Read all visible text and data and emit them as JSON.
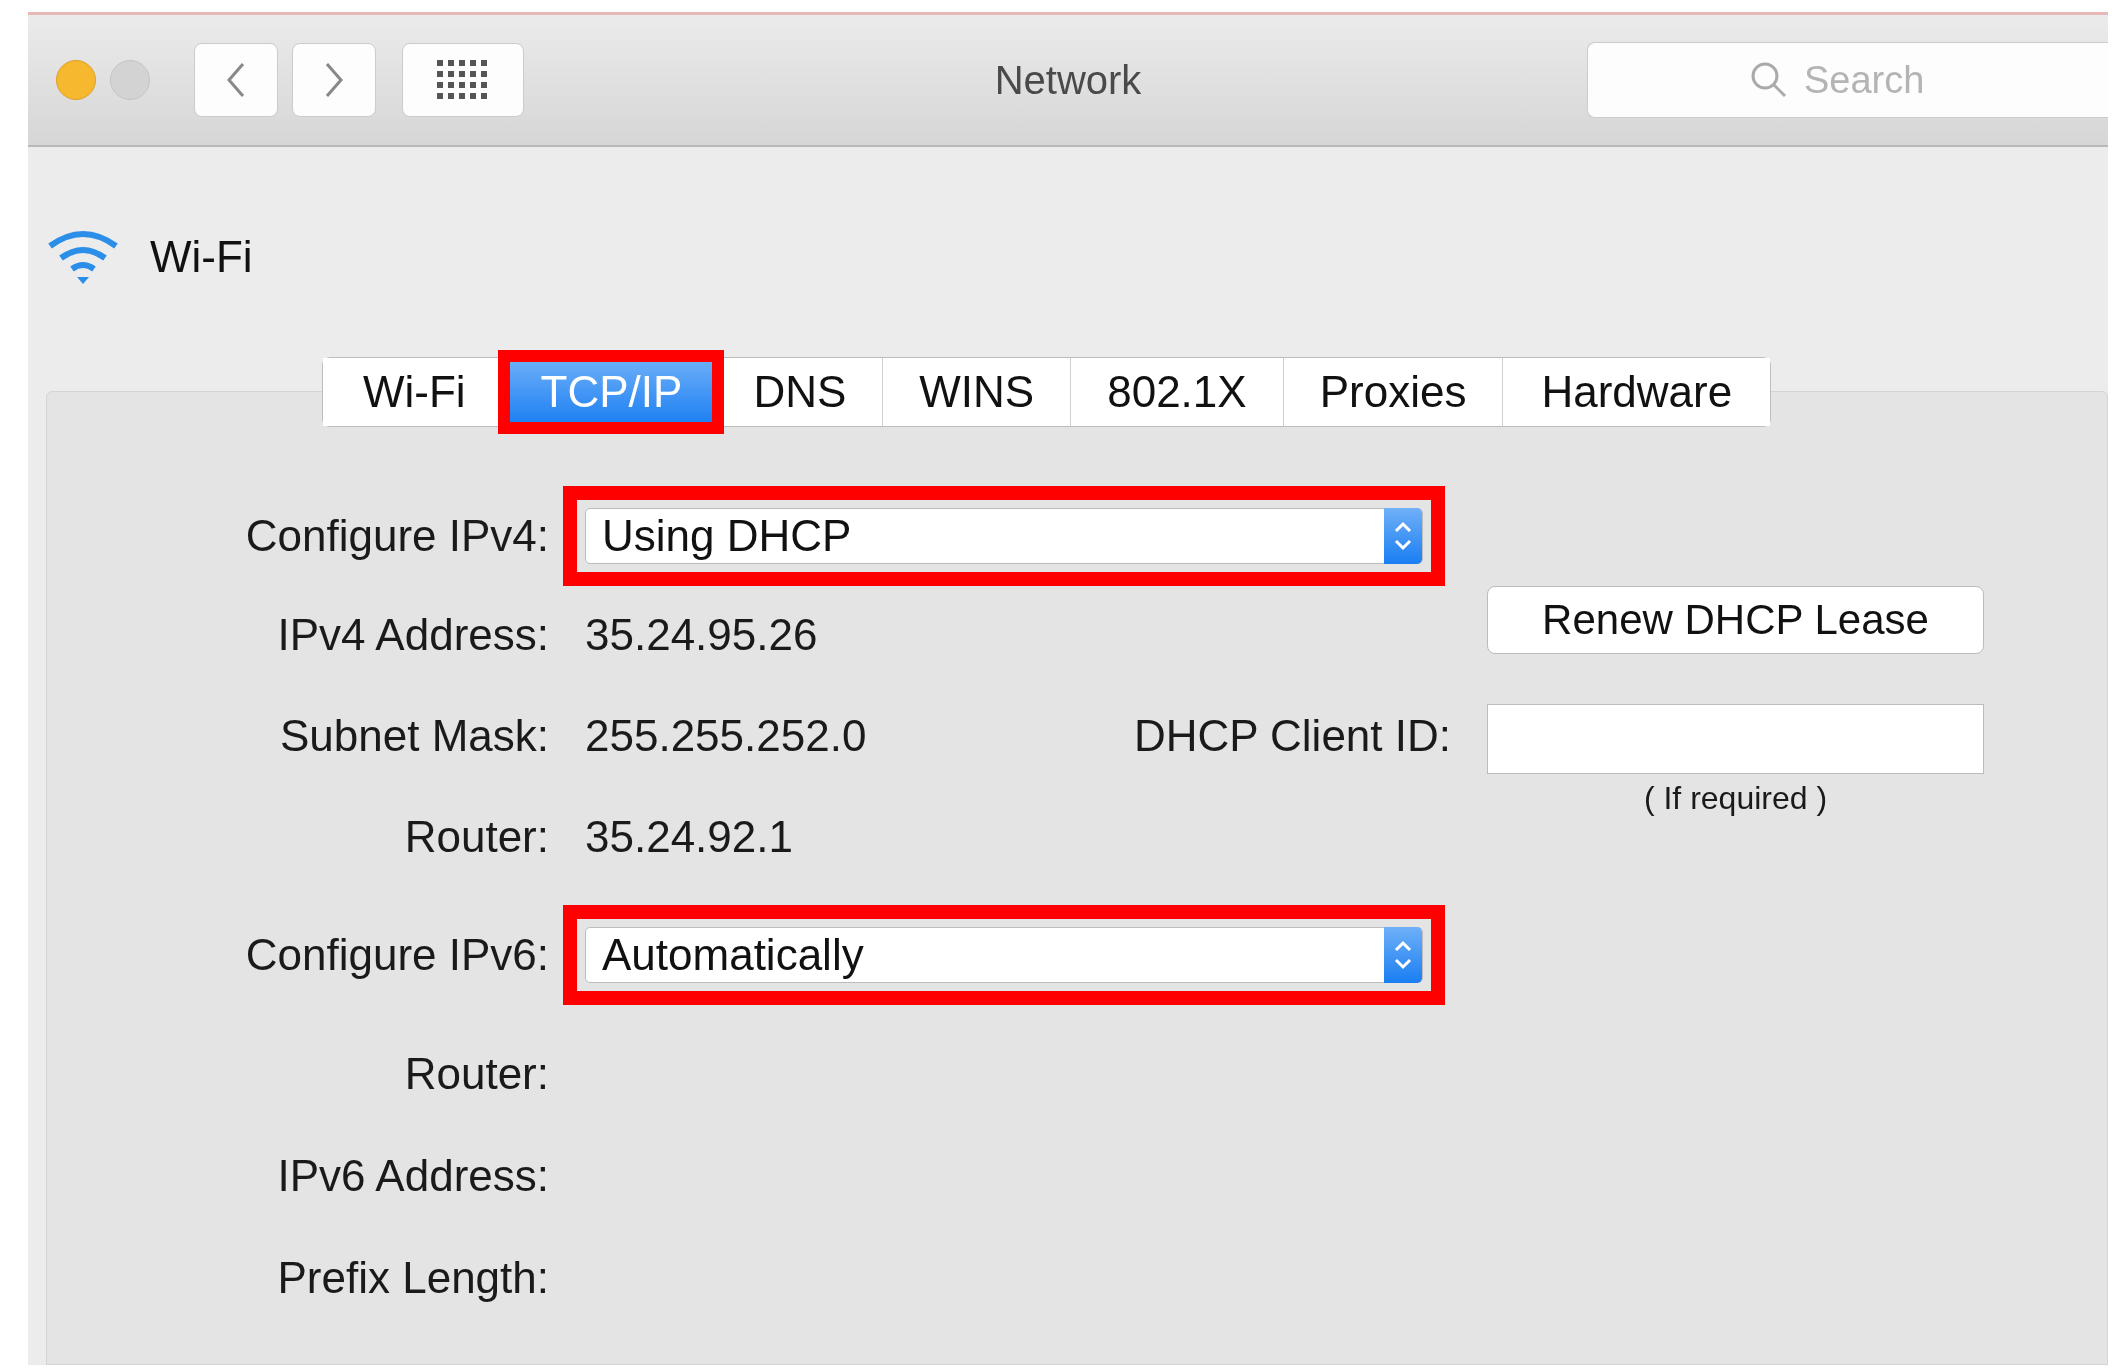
{
  "window": {
    "title": "Network"
  },
  "search": {
    "placeholder": "Search"
  },
  "service": {
    "name": "Wi-Fi"
  },
  "tabs": [
    {
      "label": "Wi-Fi",
      "selected": false,
      "highlighted": false
    },
    {
      "label": "TCP/IP",
      "selected": true,
      "highlighted": true
    },
    {
      "label": "DNS",
      "selected": false,
      "highlighted": false
    },
    {
      "label": "WINS",
      "selected": false,
      "highlighted": false
    },
    {
      "label": "802.1X",
      "selected": false,
      "highlighted": false
    },
    {
      "label": "Proxies",
      "selected": false,
      "highlighted": false
    },
    {
      "label": "Hardware",
      "selected": false,
      "highlighted": false
    }
  ],
  "ipv4": {
    "configure": {
      "label": "Configure IPv4:",
      "value": "Using DHCP",
      "highlighted": true
    },
    "rows": [
      {
        "label": "IPv4 Address:",
        "value": "35.24.95.26"
      },
      {
        "label": "Subnet Mask:",
        "value": "255.255.252.0"
      },
      {
        "label": "Router:",
        "value": "35.24.92.1"
      }
    ],
    "renew_button": "Renew DHCP Lease",
    "client_id": {
      "label": "DHCP Client ID:",
      "hint": "( If required )"
    }
  },
  "ipv6": {
    "configure": {
      "label": "Configure IPv6:",
      "value": "Automatically",
      "highlighted": true
    },
    "rows": [
      {
        "label": "Router:"
      },
      {
        "label": "IPv6 Address:"
      },
      {
        "label": "Prefix Length:"
      }
    ]
  }
}
